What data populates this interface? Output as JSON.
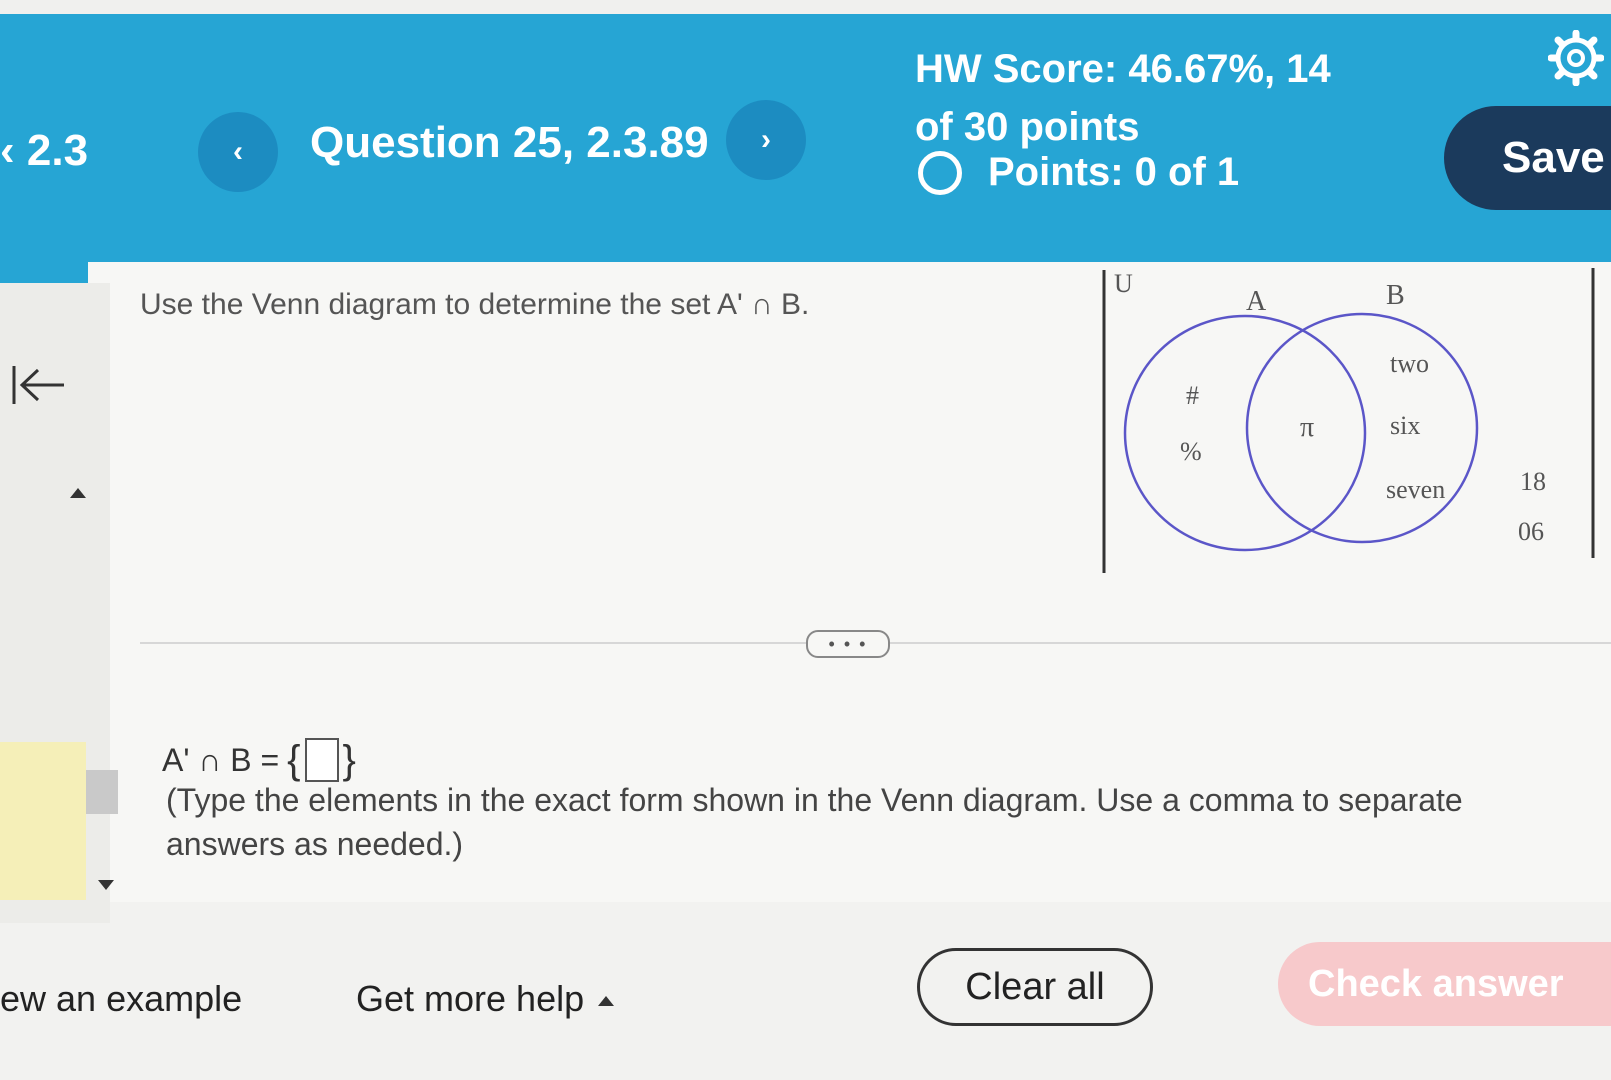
{
  "header": {
    "section": "2.3",
    "question_title": "Question 25, 2.3.89",
    "prev_icon": "chevron-left-icon",
    "next_icon": "chevron-right-icon",
    "hw_score": "HW Score: 46.67%, 14 of 30 points",
    "points": "Points: 0 of 1",
    "settings_icon": "gear-icon",
    "save_label": "Save",
    "accent_color": "#26a5d4",
    "save_color": "#1b3a5c"
  },
  "question": {
    "prompt": "Use the Venn diagram to determine the set A' ∩ B."
  },
  "venn": {
    "universe_label": "U",
    "set_a_label": "A",
    "set_b_label": "B",
    "a_only": [
      "#",
      "%"
    ],
    "intersection": [
      "π"
    ],
    "b_only": [
      "two",
      "six",
      "seven"
    ],
    "outside": [
      "18",
      "06"
    ]
  },
  "more_label": "• • •",
  "answer": {
    "expression": "A' ∩ B =",
    "open_brace": "{",
    "close_brace": "}",
    "value": "",
    "instructions": "(Type the elements in the exact form shown in the Venn diagram. Use a comma to separate answers as needed.)"
  },
  "footer": {
    "view_example": "ew an example",
    "get_more_help": "Get more help",
    "clear_all": "Clear all",
    "check_answer": "Check answer"
  }
}
